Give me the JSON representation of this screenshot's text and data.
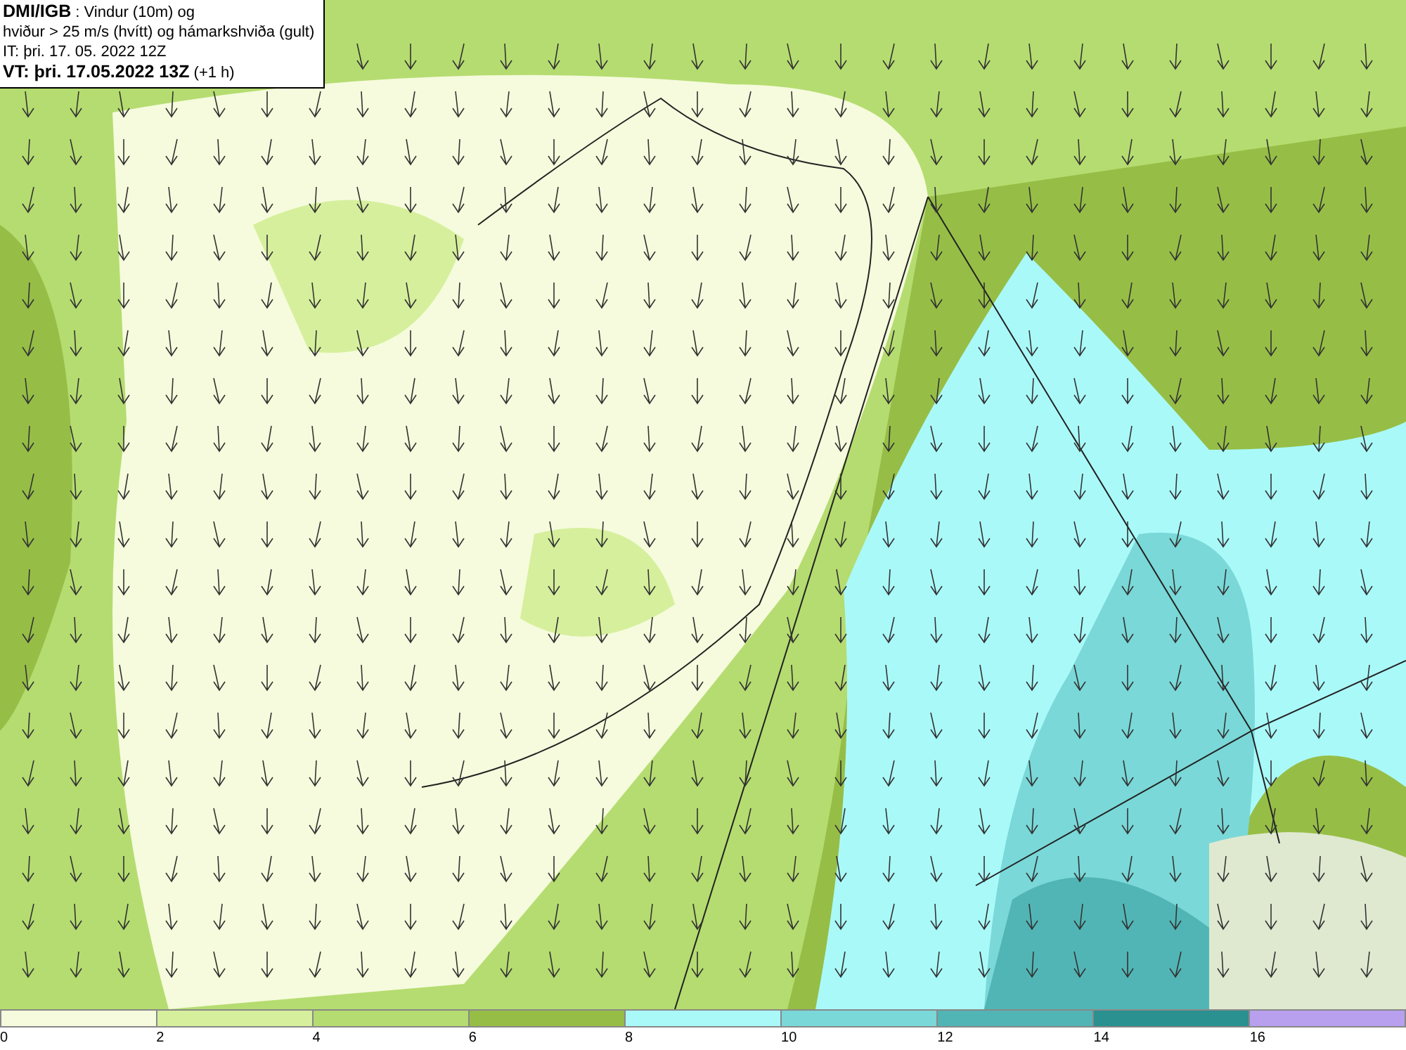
{
  "header": {
    "lines": [
      "**DMI/IGB** : Vindur (10m) og",
      "hviður > 25 m/s (hvítt) og hámarkshviða (gult)",
      "IT: þri. 17. 05. 2022 12Z",
      "**VT: þri. 17.05.2022 13Z** (+1 h)"
    ]
  },
  "legend": {
    "segments": [
      {
        "color": "#f5fbdc"
      },
      {
        "color": "#d6ef9c"
      },
      {
        "color": "#b5dc70"
      },
      {
        "color": "#96be46"
      },
      {
        "color": "#aaf9f9"
      },
      {
        "color": "#7ad8d8"
      },
      {
        "color": "#52b5b5"
      },
      {
        "color": "#2a9090"
      },
      {
        "color": "#b8a0ee"
      }
    ],
    "ticks": [
      "0",
      "2",
      "4",
      "6",
      "8",
      "10",
      "12",
      "14",
      "16"
    ]
  }
}
